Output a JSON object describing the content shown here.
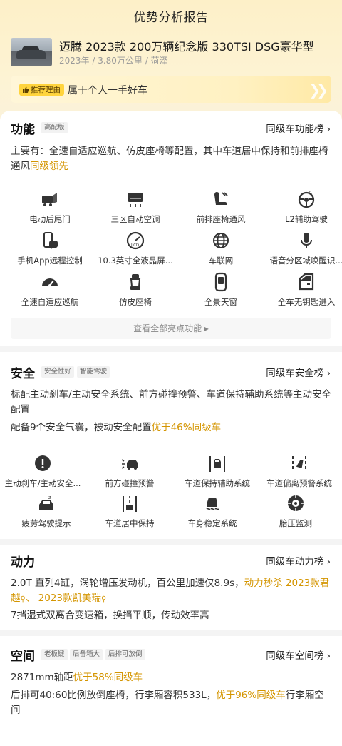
{
  "page_title": "优势分析报告",
  "car": {
    "name": "迈腾 2023款 200万辆纪念版 330TSI DSG豪华型",
    "meta": "2023年 / 3.80万公里 / 菏泽"
  },
  "recommend": {
    "badge": "推荐理由",
    "text": "属于个人一手好车"
  },
  "function": {
    "title": "功能",
    "tags": [
      "高配版"
    ],
    "rank_link": "同级车功能榜",
    "desc_main": "主要有：全速自适应巡航、仿皮座椅等配置，其中车道居中保持和前排座椅通风",
    "desc_highlight": "同级领先",
    "features": [
      {
        "label": "电动后尾门",
        "icon": "tailgate-icon"
      },
      {
        "label": "三区自动空调",
        "icon": "climate-icon"
      },
      {
        "label": "前排座椅通风",
        "icon": "seat-vent-icon"
      },
      {
        "label": "L2辅助驾驶",
        "icon": "steering-icon"
      },
      {
        "label": "手机App远程控制",
        "icon": "phone-icon"
      },
      {
        "label": "10.3英寸全液晶屏...",
        "icon": "lcd-icon"
      },
      {
        "label": "车联网",
        "icon": "globe-icon"
      },
      {
        "label": "语音分区域唤醒识...",
        "icon": "mic-icon"
      },
      {
        "label": "全速自适应巡航",
        "icon": "speedometer-icon"
      },
      {
        "label": "仿皮座椅",
        "icon": "seat-icon"
      },
      {
        "label": "全景天窗",
        "icon": "sunroof-icon"
      },
      {
        "label": "全车无钥匙进入",
        "icon": "door-icon"
      }
    ],
    "view_all": "查看全部亮点功能 ▸"
  },
  "safety": {
    "title": "安全",
    "tags": [
      "安全性好",
      "智能驾驶"
    ],
    "rank_link": "同级车安全榜",
    "desc1": "标配主动刹车/主动安全系统、前方碰撞预警、车道保持辅助系统等主动安全配置",
    "desc2_main": "配备9个安全气囊，被动安全配置",
    "desc2_highlight": "优于46%同级车",
    "features": [
      {
        "label": "主动刹车/主动安全...",
        "icon": "brake-icon"
      },
      {
        "label": "前方碰撞预警",
        "icon": "collision-icon"
      },
      {
        "label": "车道保持辅助系统",
        "icon": "lane-keep-icon"
      },
      {
        "label": "车道偏离预警系统",
        "icon": "lane-depart-icon"
      },
      {
        "label": "疲劳驾驶提示",
        "icon": "fatigue-icon"
      },
      {
        "label": "车道居中保持",
        "icon": "lane-center-icon"
      },
      {
        "label": "车身稳定系统",
        "icon": "stability-icon"
      },
      {
        "label": "胎压监测",
        "icon": "tire-icon"
      }
    ]
  },
  "power": {
    "title": "动力",
    "rank_link": "同级车动力榜",
    "desc1_main": "2.0T 直列4缸，涡轮增压发动机，百公里加速仅8.9s，",
    "desc1_highlight": "动力秒杀 2023款君越",
    "desc1_sep": "、",
    "desc1_highlight2": "2023款凯美瑞",
    "desc2": "7挡湿式双离合变速箱，换挡平顺，传动效率高"
  },
  "space": {
    "title": "空间",
    "tags": [
      "老板键",
      "后备箱大",
      "后排可放倒"
    ],
    "rank_link": "同级车空间榜",
    "desc1_main": "2871mm轴距",
    "desc1_highlight": "优于58%同级车",
    "desc2_main": "后排可40:60比例放倒座椅，行李厢容积533L，",
    "desc2_highlight": "优于96%同级车",
    "desc2_tail": "行李厢空间"
  },
  "colors": {
    "highlight": "#d49500",
    "badge": "#ffd43d",
    "top_gradient": "#fdf0c8"
  }
}
